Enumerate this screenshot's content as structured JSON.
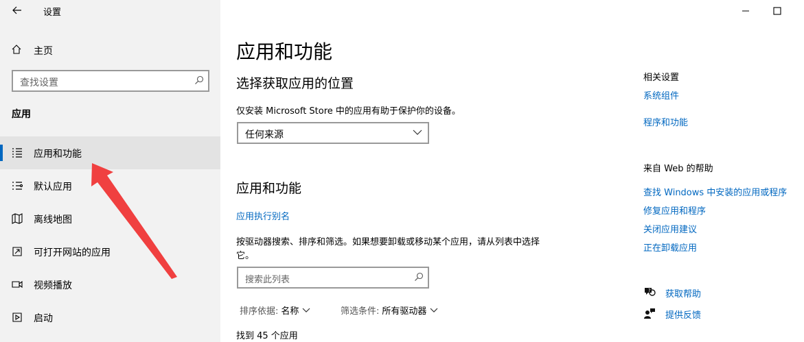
{
  "window": {
    "title": "设置",
    "minimize_icon": "minimize-icon",
    "maximize_icon": "maximize-icon"
  },
  "sidebar": {
    "home_label": "主页",
    "search_placeholder": "查找设置",
    "section": "应用",
    "items": [
      {
        "label": "应用和功能",
        "icon": "apps-list-icon",
        "active": true
      },
      {
        "label": "默认应用",
        "icon": "default-apps-icon",
        "active": false
      },
      {
        "label": "离线地图",
        "icon": "map-icon",
        "active": false
      },
      {
        "label": "可打开网站的应用",
        "icon": "open-website-icon",
        "active": false
      },
      {
        "label": "视频播放",
        "icon": "video-icon",
        "active": false
      },
      {
        "label": "启动",
        "icon": "startup-icon",
        "active": false
      }
    ]
  },
  "main": {
    "title": "应用和功能",
    "choose_location_title": "选择获取应用的位置",
    "choose_location_desc": "仅安装 Microsoft Store 中的应用有助于保护你的设备。",
    "source_dropdown_value": "任何来源",
    "apps_title": "应用和功能",
    "alias_link": "应用执行别名",
    "help_text": "按驱动器搜索、排序和筛选。如果想要卸载或移动某个应用，请从列表中选择它。",
    "list_search_placeholder": "搜索此列表",
    "sort_label": "排序依据:",
    "sort_value": "名称",
    "filter_label": "筛选条件:",
    "filter_value": "所有驱动器",
    "count_text": "找到 45 个应用"
  },
  "right": {
    "related_title": "相关设置",
    "related_links": [
      "系统组件",
      "程序和功能"
    ],
    "web_help_title": "来自 Web 的帮助",
    "web_links": [
      "查找 Windows 中安装的应用或程序",
      "修复应用和程序",
      "关闭应用建议",
      "正在卸载应用"
    ],
    "get_help": "获取帮助",
    "feedback": "提供反馈"
  },
  "colors": {
    "accent": "#0067c0",
    "annotation_arrow": "#f04040"
  }
}
